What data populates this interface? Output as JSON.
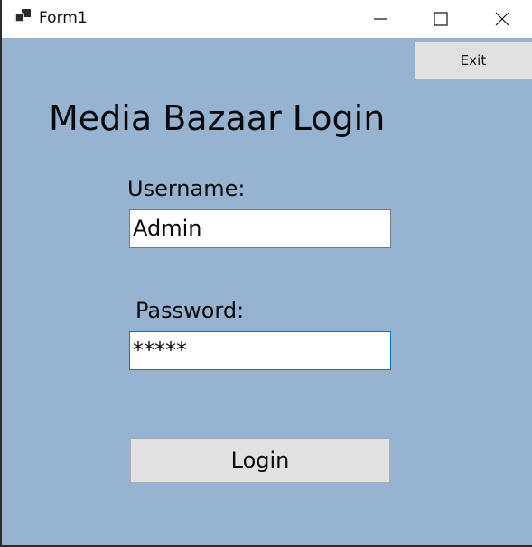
{
  "window": {
    "title": "Form1",
    "icons": {
      "app": "app-icon",
      "minimize": "minimize-icon",
      "maximize": "maximize-icon",
      "close": "close-icon"
    }
  },
  "toolbar": {
    "exit_label": "Exit"
  },
  "form": {
    "heading": "Media Bazaar Login",
    "username_label": "Username:",
    "username_value": "Admin",
    "password_label": "Password:",
    "password_value": "*****",
    "login_label": "Login"
  },
  "colors": {
    "form_background": "#97b3d2",
    "button_background": "#e1e1e1",
    "focus_border": "#0078d7"
  }
}
